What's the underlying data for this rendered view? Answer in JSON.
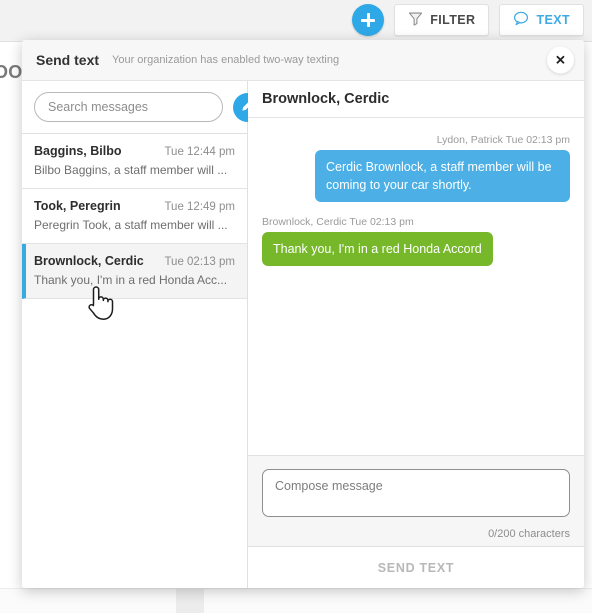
{
  "background": {
    "clipped_heading": "OON",
    "accent_blue": "#2fa8e8"
  },
  "toolbar": {
    "add_button": {
      "icon": "plus-icon",
      "label": ""
    },
    "filter_button": {
      "icon": "filter-icon",
      "label": "FILTER"
    },
    "text_button": {
      "icon": "chat-bubble-icon",
      "label": "TEXT",
      "color": "#3fa9e5"
    }
  },
  "modal": {
    "title": "Send text",
    "subtitle": "Your organization has enabled two-way texting",
    "close_label": "✕"
  },
  "conversations": {
    "search": {
      "placeholder": "Search messages",
      "value": ""
    },
    "compose_button_icon": "pencil-icon",
    "items": [
      {
        "name": "Baggins, Bilbo",
        "time": "Tue 12:44 pm",
        "preview": "Bilbo Baggins, a staff member will ...",
        "selected": false
      },
      {
        "name": "Took, Peregrin",
        "time": "Tue 12:49 pm",
        "preview": "Peregrin Took, a staff member will ...",
        "selected": false
      },
      {
        "name": "Brownlock, Cerdic",
        "time": "Tue 02:13 pm",
        "preview": "Thank you, I'm in a red Honda Acc...",
        "selected": true
      }
    ]
  },
  "thread": {
    "title": "Brownlock, Cerdic",
    "messages": [
      {
        "direction": "outgoing",
        "sender": "Lydon, Patrick",
        "time": "Tue 02:13 pm",
        "meta": "Lydon, Patrick  Tue 02:13 pm",
        "body": "Cerdic Brownlock, a staff member will be coming to your car shortly.",
        "color": "#4cafe6"
      },
      {
        "direction": "incoming",
        "sender": "Brownlock, Cerdic",
        "time": "Tue 02:13 pm",
        "meta": "Brownlock, Cerdic  Tue 02:13 pm",
        "body": "Thank you, I'm in a red Honda Accord",
        "color": "#76b82a"
      }
    ],
    "compose": {
      "placeholder": "Compose message",
      "value": "",
      "char_count": "0/200 characters"
    },
    "send_button_label": "SEND TEXT"
  }
}
